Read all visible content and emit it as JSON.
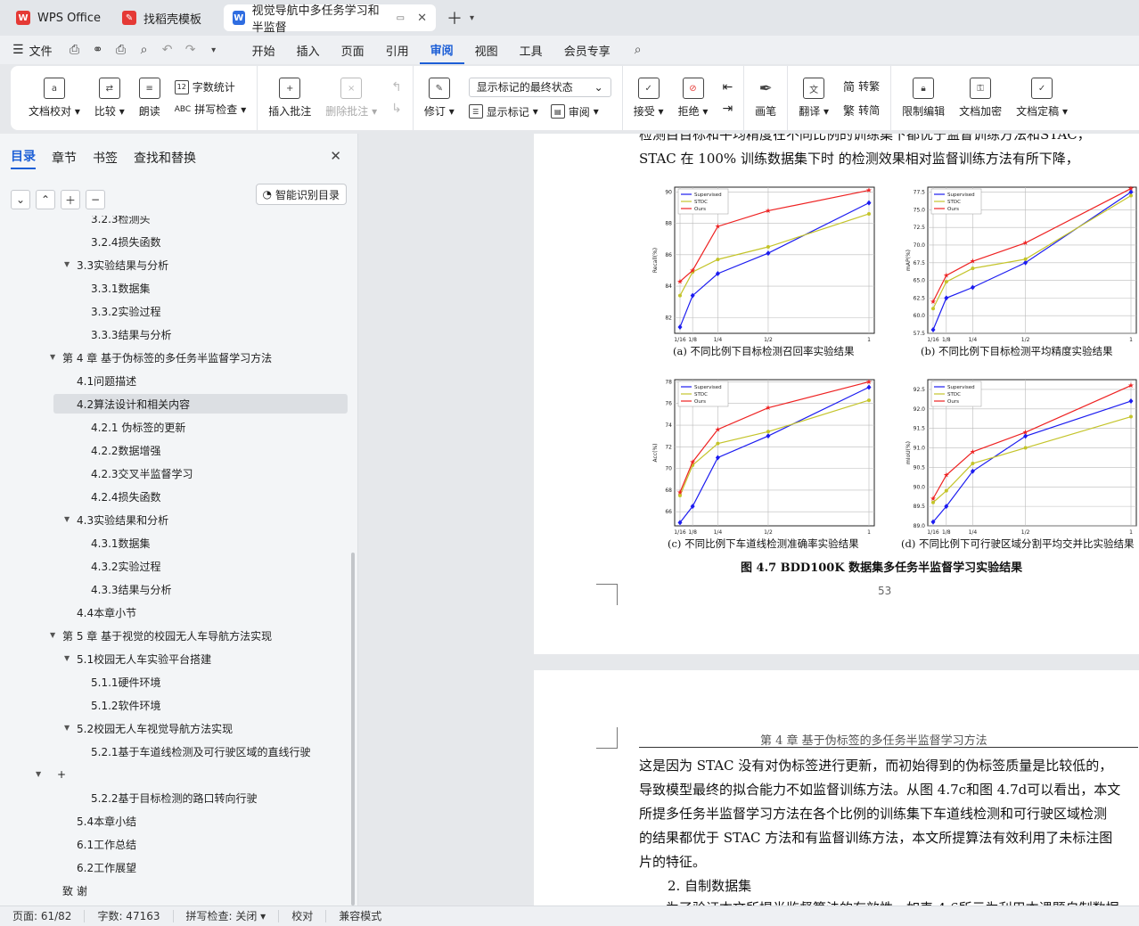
{
  "tabs": [
    {
      "label": "WPS Office",
      "icon": "wps-logo-icon",
      "color": "#e53935"
    },
    {
      "label": "找稻壳模板",
      "icon": "docer-logo-icon",
      "color": "#e53935"
    },
    {
      "label": "视觉导航中多任务学习和半监督",
      "icon": "word-doc-icon",
      "color": "#2f6de1"
    }
  ],
  "menu": {
    "file": "文件",
    "items": [
      "开始",
      "插入",
      "页面",
      "引用",
      "审阅",
      "视图",
      "工具",
      "会员专享"
    ],
    "active": "审阅"
  },
  "ribbon": {
    "doc_check": "文档校对",
    "compare": "比较",
    "read_aloud": "朗读",
    "word_count": "字数统计",
    "spell_check": "拼写检查",
    "insert_comment": "插入批注",
    "delete_comment": "删除批注",
    "revise": "修订",
    "markup_state": "显示标记的最终状态",
    "show_markup": "显示标记",
    "review": "审阅",
    "accept": "接受",
    "reject": "拒绝",
    "ink": "画笔",
    "translate": "翻译",
    "to_traditional": "转繁",
    "to_simplified": "转简",
    "restrict_edit": "限制编辑",
    "encrypt": "文档加密",
    "finalize": "文档定稿",
    "simp_glyph": "简",
    "trad_glyph": "繁"
  },
  "left_panel": {
    "tabs": [
      "目录",
      "章节",
      "书签",
      "查找和替换"
    ],
    "active_tab": "目录",
    "smart_toc": "智能识别目录",
    "toc": [
      {
        "label": "3.2.3检测头",
        "level": 3,
        "arrow": false
      },
      {
        "label": "3.2.4损失函数",
        "level": 3,
        "arrow": false
      },
      {
        "label": "3.3实验结果与分析",
        "level": 2,
        "arrow": true
      },
      {
        "label": "3.3.1数据集",
        "level": 3,
        "arrow": false
      },
      {
        "label": "3.3.2实验过程",
        "level": 3,
        "arrow": false
      },
      {
        "label": "3.3.3结果与分析",
        "level": 3,
        "arrow": false
      },
      {
        "label": "第 4 章  基于伪标签的多任务半监督学习方法",
        "level": 1,
        "arrow": true
      },
      {
        "label": "4.1问题描述",
        "level": 2,
        "arrow": false
      },
      {
        "label": "4.2算法设计和相关内容",
        "level": 2,
        "arrow": true,
        "selected": true
      },
      {
        "label": "4.2.1  伪标签的更新",
        "level": 3,
        "arrow": false
      },
      {
        "label": "4.2.2数据增强",
        "level": 3,
        "arrow": false
      },
      {
        "label": "4.2.3交叉半监督学习",
        "level": 3,
        "arrow": false
      },
      {
        "label": "4.2.4损失函数",
        "level": 3,
        "arrow": false
      },
      {
        "label": "4.3实验结果和分析",
        "level": 2,
        "arrow": true
      },
      {
        "label": "4.3.1数据集",
        "level": 3,
        "arrow": false
      },
      {
        "label": "4.3.2实验过程",
        "level": 3,
        "arrow": false
      },
      {
        "label": "4.3.3结果与分析",
        "level": 3,
        "arrow": false
      },
      {
        "label": "4.4本章小节",
        "level": 2,
        "arrow": false
      },
      {
        "label": "第 5 章  基于视觉的校园无人车导航方法实现",
        "level": 1,
        "arrow": true
      },
      {
        "label": "5.1校园无人车实验平台搭建",
        "level": 2,
        "arrow": true
      },
      {
        "label": "5.1.1硬件环境",
        "level": 3,
        "arrow": false
      },
      {
        "label": "5.1.2软件环境",
        "level": 3,
        "arrow": false
      },
      {
        "label": "5.2校园无人车视觉导航方法实现",
        "level": 2,
        "arrow": true
      },
      {
        "label": "5.2.1基于车道线检测及可行驶区域的直线行驶",
        "level": 3,
        "arrow": false
      },
      {
        "label": "+",
        "level": 1,
        "arrow": true,
        "plus": true
      },
      {
        "label": "5.2.2基于目标检测的路口转向行驶",
        "level": 3,
        "arrow": false
      },
      {
        "label": "5.4本章小结",
        "level": 2,
        "arrow": false
      },
      {
        "label": "6.1工作总结",
        "level": 2,
        "arrow": false
      },
      {
        "label": "6.2工作展望",
        "level": 2,
        "arrow": false
      },
      {
        "label": "致  谢",
        "level": 1,
        "arrow": false
      }
    ]
  },
  "document": {
    "page1_line_top": "检测目目标和平均精度在不同比例的训练集下都优于监督训练方法和STAC，",
    "page1_line2": "STAC 在 100% 训练数据集下时  的检测效果相对监督训练方法有所下降，",
    "captions": [
      "(a) 不同比例下目标检测召回率实验结果",
      "(b) 不同比例下目标检测平均精度实验结果",
      "(c) 不同比例下车道线检测准确率实验结果",
      "(d) 不同比例下可行驶区域分割平均交并比实验结果"
    ],
    "figure_caption": "图 4.7    BDD100K 数据集多任务半监督学习实验结果",
    "page_number": "53",
    "page2_header": "第 4 章    基于伪标签的多任务半监督学习方法",
    "page2_lines": [
      "这是因为  STAC 没有对伪标签进行更新，而初始得到的伪标签质量是比较低的，",
      "导致模型最终的拟合能力不如监督训练方法。从图  4.7c和图  4.7d可以看出，本文",
      "所提多任务半监督学习方法在各个比例的训练集下车道线检测和可行驶区域检测",
      "的结果都优于  STAC 方法和有监督训练方法，本文所提算法有效利用了未标注图",
      "片的特征。"
    ],
    "subheading": "2. 自制数据集",
    "page2_partial": "为了验证本文所提半监督算法的有效性，如表  4.6所示为利用本课题自制数据"
  },
  "chart_data": [
    {
      "type": "line",
      "title": "",
      "xlabel": "",
      "ylabel": "Recall(%)",
      "x": [
        "1/16",
        "1/8",
        "1/4",
        "1/2",
        "1"
      ],
      "yticks": [
        82,
        84,
        86,
        88,
        90
      ],
      "ylim": [
        81,
        90.3
      ],
      "legend_position": "top-left",
      "series": [
        {
          "name": "Supervised",
          "color": "#1c1cf0",
          "marker": "diamond",
          "values": [
            81.4,
            83.4,
            84.8,
            86.1,
            89.3
          ]
        },
        {
          "name": "STDC",
          "color": "#c4c42a",
          "marker": "circle",
          "values": [
            83.4,
            84.9,
            85.7,
            86.5,
            88.6
          ]
        },
        {
          "name": "Ours",
          "color": "#ee2222",
          "marker": "star",
          "values": [
            84.3,
            85.0,
            87.8,
            88.8,
            90.1
          ]
        }
      ]
    },
    {
      "type": "line",
      "title": "",
      "xlabel": "",
      "ylabel": "mAP(%)",
      "x": [
        "1/16",
        "1/8",
        "1/4",
        "1/2",
        "1"
      ],
      "yticks": [
        57.5,
        60.0,
        62.5,
        65.0,
        67.5,
        70.0,
        72.5,
        75.0,
        77.5
      ],
      "ylim": [
        57.5,
        78.2
      ],
      "legend_position": "top-left",
      "series": [
        {
          "name": "Supervised",
          "color": "#1c1cf0",
          "marker": "diamond",
          "values": [
            58.0,
            62.5,
            64.0,
            67.5,
            77.5
          ]
        },
        {
          "name": "STDC",
          "color": "#c4c42a",
          "marker": "circle",
          "values": [
            61.0,
            64.8,
            66.7,
            68.0,
            77.0
          ]
        },
        {
          "name": "Ours",
          "color": "#ee2222",
          "marker": "star",
          "values": [
            62.0,
            65.7,
            67.7,
            70.3,
            78.0
          ]
        }
      ]
    },
    {
      "type": "line",
      "title": "",
      "xlabel": "",
      "ylabel": "Acc(%)",
      "x": [
        "1/16",
        "1/8",
        "1/4",
        "1/2",
        "1"
      ],
      "yticks": [
        66,
        68,
        70,
        72,
        74,
        76,
        78
      ],
      "ylim": [
        64.7,
        78.2
      ],
      "legend_position": "top-left",
      "series": [
        {
          "name": "Supervised",
          "color": "#1c1cf0",
          "marker": "diamond",
          "values": [
            65.0,
            66.5,
            71.0,
            73.0,
            77.5
          ]
        },
        {
          "name": "STDC",
          "color": "#c4c42a",
          "marker": "circle",
          "values": [
            67.5,
            70.3,
            72.3,
            73.4,
            76.3
          ]
        },
        {
          "name": "Ours",
          "color": "#ee2222",
          "marker": "star",
          "values": [
            67.8,
            70.6,
            73.6,
            75.6,
            78.0
          ]
        }
      ]
    },
    {
      "type": "line",
      "title": "",
      "xlabel": "",
      "ylabel": "mIoU(%)",
      "x": [
        "1/16",
        "1/8",
        "1/4",
        "1/2",
        "1"
      ],
      "yticks": [
        89.0,
        89.5,
        90.0,
        90.5,
        91.0,
        91.5,
        92.0,
        92.5
      ],
      "ylim": [
        89.0,
        92.75
      ],
      "legend_position": "top-left",
      "series": [
        {
          "name": "Supervised",
          "color": "#1c1cf0",
          "marker": "diamond",
          "values": [
            89.1,
            89.5,
            90.4,
            91.3,
            92.2
          ]
        },
        {
          "name": "STDC",
          "color": "#c4c42a",
          "marker": "circle",
          "values": [
            89.6,
            89.9,
            90.6,
            91.0,
            91.8
          ]
        },
        {
          "name": "Ours",
          "color": "#ee2222",
          "marker": "star",
          "values": [
            89.7,
            90.3,
            90.9,
            91.4,
            92.6
          ]
        }
      ]
    }
  ],
  "status": {
    "page": "页面: 61/82",
    "words": "字数: 47163",
    "spell": "拼写检查: 关闭",
    "proof": "校对",
    "compat": "兼容模式"
  }
}
